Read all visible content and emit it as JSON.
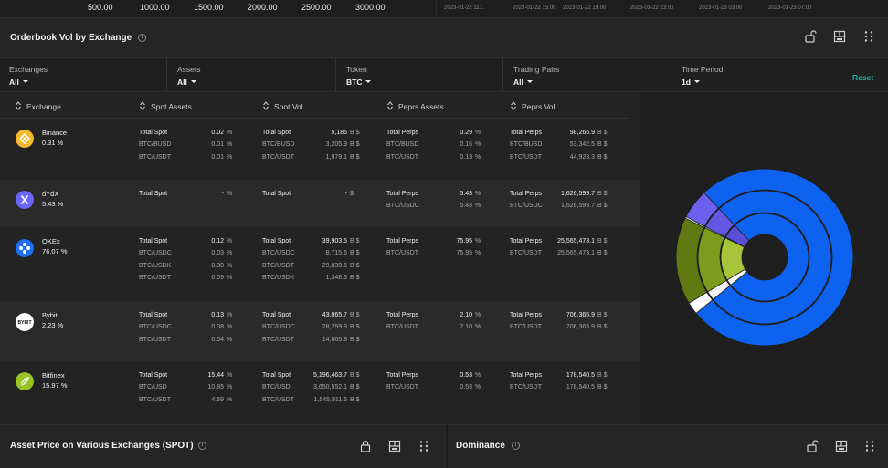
{
  "top_axis": {
    "x_ticks": [
      "500.00",
      "1000.00",
      "1500.00",
      "2000.00",
      "2500.00",
      "3000.00"
    ],
    "date_ticks": [
      "2023-01-22 11:...",
      "2023-01-22 15:00",
      "2023-01-22 19:00",
      "2023-01-22 23:00",
      "2023-01-23 03:00",
      "2023-01-23 07:00"
    ]
  },
  "panel": {
    "title": "Orderbook Vol by Exchange",
    "info": "i"
  },
  "filters": [
    {
      "label": "Exchanges",
      "value": "All"
    },
    {
      "label": "Assets",
      "value": "All"
    },
    {
      "label": "Token",
      "value": "BTC"
    },
    {
      "label": "Trading Pairs",
      "value": "All"
    },
    {
      "label": "Time Period",
      "value": "1d"
    }
  ],
  "reset_label": "Reset",
  "table": {
    "columns": [
      "Exchange",
      "Spot Assets",
      "Spot Vol",
      "Peprs Assets",
      "Peprs Vol"
    ],
    "rows": [
      {
        "name": "Binance",
        "share": "0.31",
        "share_unit": "%",
        "spot_assets": [
          [
            "Total Spot",
            "0.02"
          ],
          [
            "BTC/BUSD",
            "0.01"
          ],
          [
            "BTC/USDT",
            "0.01"
          ]
        ],
        "spot_vol": [
          [
            "Total Spot",
            "5,185"
          ],
          [
            "BTC/BUSD",
            "3,205.9"
          ],
          [
            "BTC/USDT",
            "1,979.1"
          ]
        ],
        "perp_assets": [
          [
            "Total Perps",
            "0.29"
          ],
          [
            "BTC/BUSD",
            "0.16"
          ],
          [
            "BTC/USDT",
            "0.13"
          ]
        ],
        "perp_vol": [
          [
            "Total Perps",
            "98,265.9"
          ],
          [
            "BTC/BUSD",
            "53,342.5"
          ],
          [
            "BTC/USDT",
            "44,923.3"
          ]
        ]
      },
      {
        "name": "dYdX",
        "share": "5.43",
        "share_unit": "%",
        "spot_assets": [
          [
            "Total Spot",
            "-"
          ]
        ],
        "spot_vol": [
          [
            "Total Spot",
            "-"
          ]
        ],
        "perp_assets": [
          [
            "Total Perps",
            "5.43"
          ],
          [
            "BTC/USDC",
            "5.43"
          ]
        ],
        "perp_vol": [
          [
            "Total Perps",
            "1,626,599.7"
          ],
          [
            "BTC/USDC",
            "1,626,599.7"
          ]
        ]
      },
      {
        "name": "OKEx",
        "share": "76.07",
        "share_unit": "%",
        "spot_assets": [
          [
            "Total Spot",
            "0.12"
          ],
          [
            "BTC/USDC",
            "0.03"
          ],
          [
            "BTC/USDK",
            "0.00"
          ],
          [
            "BTC/USDT",
            "0.09"
          ]
        ],
        "spot_vol": [
          [
            "Total Spot",
            "39,903.5"
          ],
          [
            "BTC/USDC",
            "8,715.6"
          ],
          [
            "BTC/USDT",
            "29,839.6"
          ],
          [
            "BTC/USDK",
            "1,348.3"
          ]
        ],
        "perp_assets": [
          [
            "Total Perps",
            "75.95"
          ],
          [
            "BTC/USDT",
            "75.95"
          ]
        ],
        "perp_vol": [
          [
            "Total Perps",
            "25,565,473.1"
          ],
          [
            "BTC/USDT",
            "25,565,473.1"
          ]
        ]
      },
      {
        "name": "Bybit",
        "share": "2.23",
        "share_unit": "%",
        "spot_assets": [
          [
            "Total Spot",
            "0.13"
          ],
          [
            "BTC/USDC",
            "0.08"
          ],
          [
            "BTC/USDT",
            "0.04"
          ]
        ],
        "spot_vol": [
          [
            "Total Spot",
            "43,065.7"
          ],
          [
            "BTC/USDC",
            "28,259.9"
          ],
          [
            "BTC/USDT",
            "14,805.8"
          ]
        ],
        "perp_assets": [
          [
            "Total Perps",
            "2.10"
          ],
          [
            "BTC/USDT",
            "2.10"
          ]
        ],
        "perp_vol": [
          [
            "Total Perps",
            "706,365.9"
          ],
          [
            "BTC/USDT",
            "706,365.9"
          ]
        ]
      },
      {
        "name": "Bitfinex",
        "share": "15.97",
        "share_unit": "%",
        "spot_assets": [
          [
            "Total Spot",
            "15.44"
          ],
          [
            "BTC/USD",
            "10.85"
          ],
          [
            "BTC/USDT",
            "4.59"
          ]
        ],
        "spot_vol": [
          [
            "Total Spot",
            "5,196,463.7"
          ],
          [
            "BTC/USD",
            "3,650,552.1"
          ],
          [
            "BTC/USDT",
            "1,545,911.6"
          ]
        ],
        "perp_assets": [
          [
            "Total Perps",
            "0.53"
          ],
          [
            "BTC/USDT",
            "0.53"
          ]
        ],
        "perp_vol": [
          [
            "Total Perps",
            "178,540.5"
          ],
          [
            "BTC/USDT",
            "178,540.5"
          ]
        ]
      }
    ],
    "pct_unit": "%",
    "vol_unit": "B $",
    "dash_vol_unit": "$"
  },
  "chart_data": {
    "type": "sunburst",
    "series": [
      {
        "name": "Binance",
        "value": 0.31,
        "color": "#ffffff"
      },
      {
        "name": "dYdX",
        "value": 5.43,
        "color": "#6656e6"
      },
      {
        "name": "OKEx",
        "value": 76.07,
        "color": "#0d63f0"
      },
      {
        "name": "Bybit",
        "value": 2.23,
        "color": "#ffffff"
      },
      {
        "name": "Bitfinex",
        "value": 15.97,
        "color": "#6f8c16"
      }
    ]
  },
  "bottom": {
    "left_title": "Asset Price on Various Exchanges (SPOT)",
    "right_title": "Dominance"
  },
  "colors": {
    "accent": "#27b5a5",
    "binance": "#f3ba2f",
    "dydx": "#6966ff",
    "okex": "#1f6ff5",
    "bitfinex": "#97c224"
  }
}
